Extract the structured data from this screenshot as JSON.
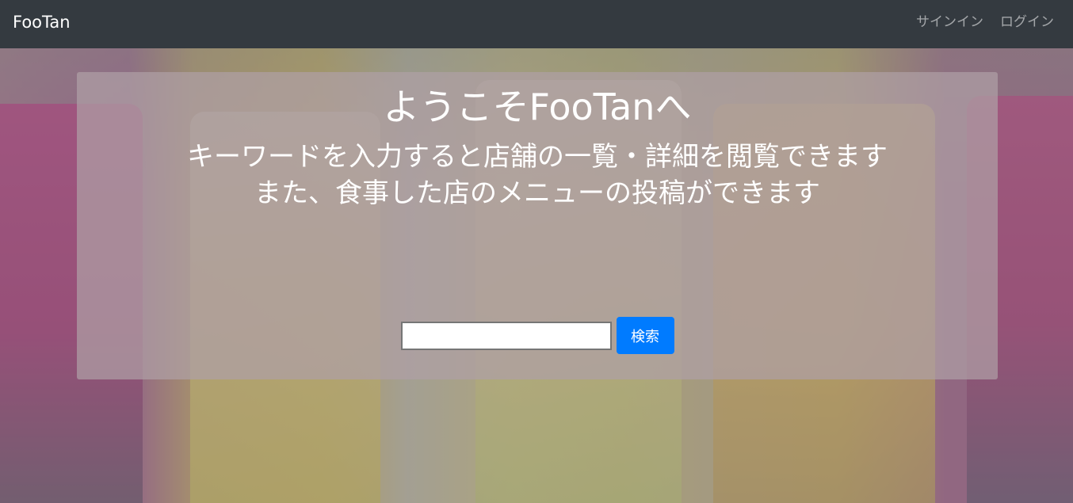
{
  "navbar": {
    "brand": "FooTan",
    "links": [
      "サインイン",
      "ログイン"
    ]
  },
  "hero": {
    "title": "ようこそFooTanへ",
    "subtitle_line1": "キーワードを入力すると店舗の一覧・詳細を閲覧できます",
    "subtitle_line2": "また、食事した店のメニューの投稿ができます"
  },
  "search": {
    "value": "",
    "button_label": "検索",
    "button_color": "#007bff"
  },
  "colors": {
    "navbar_bg": "#343a40",
    "text_on_dark": "#ffffff"
  }
}
